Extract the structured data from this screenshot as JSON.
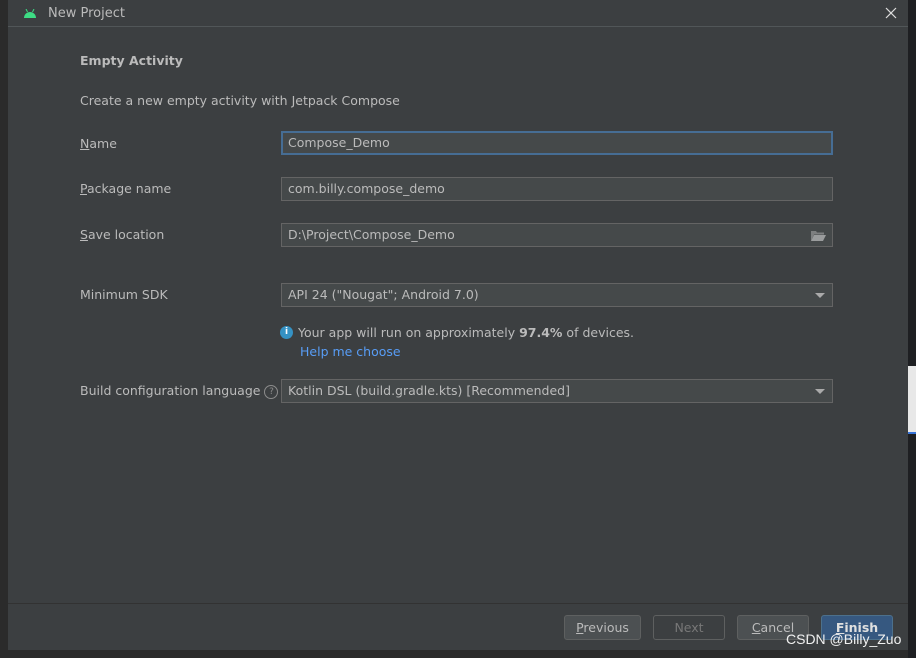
{
  "window": {
    "title": "New Project"
  },
  "heading": "Empty Activity",
  "description": "Create a new empty activity with Jetpack Compose",
  "form": {
    "name": {
      "label_mn": "N",
      "label_rest": "ame",
      "value": "Compose_Demo"
    },
    "package": {
      "label_mn": "P",
      "label_rest": "ackage name",
      "value": "com.billy.compose_demo"
    },
    "save": {
      "label_mn": "S",
      "label_rest": "ave location",
      "value": "D:\\Project\\Compose_Demo"
    },
    "sdk": {
      "label": "Minimum SDK",
      "value": "API 24 (\"Nougat\"; Android 7.0)"
    },
    "info": {
      "pre": "Your app will run on approximately ",
      "percent": "97.4%",
      "post": " of devices."
    },
    "help_link": "Help me choose",
    "build": {
      "label": "Build configuration language",
      "value": "Kotlin DSL (build.gradle.kts) [Recommended]"
    }
  },
  "buttons": {
    "previous": {
      "mn": "P",
      "rest": "revious"
    },
    "next": "Next",
    "cancel": {
      "mn": "C",
      "rest": "ancel"
    },
    "finish": {
      "mn": "F",
      "rest": "inish"
    }
  },
  "watermark": "CSDN @Billy_Zuo",
  "colors": {
    "background": "#3c3f41",
    "accent": "#365880",
    "link": "#589df6",
    "focus": "#466d94"
  }
}
